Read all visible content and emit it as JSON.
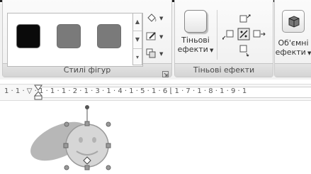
{
  "ribbon": {
    "shape_styles_group": {
      "label": "Стилі фігур",
      "swatch_colors": [
        "#0a0a0a",
        "#7a7a7a",
        "#7a7a7a"
      ],
      "fill_icon": "paint-bucket-icon",
      "outline_icon": "pen-outline-icon",
      "change_shape_icon": "change-shape-icon",
      "launcher_icon": "dialog-launcher-icon"
    },
    "shadow_effects_group": {
      "label": "Тіньові ефекти",
      "button_line1": "Тіньові",
      "button_line2": "ефекти",
      "nudge_icons": [
        "nudge-up-icon",
        "nudge-left-icon",
        "shadow-toggle-icon",
        "nudge-right-icon",
        "nudge-down-icon"
      ]
    },
    "effects_3d_group": {
      "button_line1": "Об'ємні",
      "button_line2": "ефекти"
    }
  },
  "ruler": {
    "text": "1 · 1 · ▽ · 1 · 1 · 1 · 2 · 1 · 3 · 1 · 4 · 1 · 5 · 1 · 6 ⌊ 1 · 7 · 1 · 8 · 1 · 9 · 1"
  }
}
